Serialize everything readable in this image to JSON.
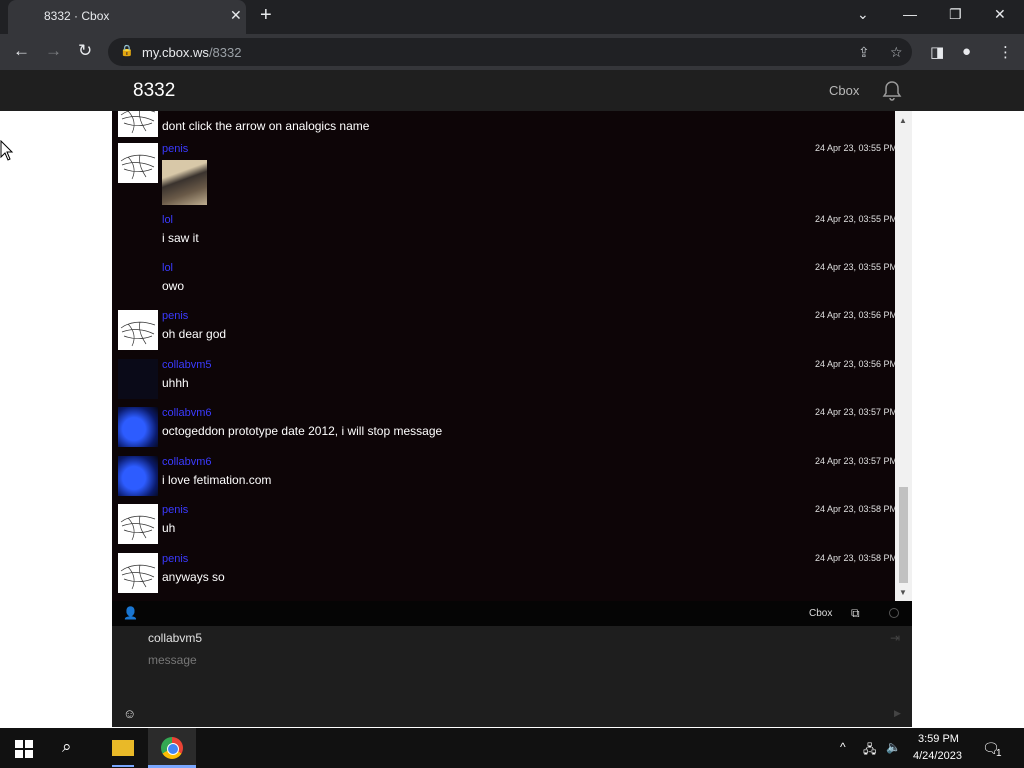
{
  "browser": {
    "tab_title": "8332 · Cbox",
    "tab_close": "✕",
    "new_tab": "+",
    "url_host": "my.cbox.ws",
    "url_path": "/8332"
  },
  "header": {
    "title": "8332",
    "link": "Cbox"
  },
  "messages": [
    {
      "user": "",
      "text": "dont click the arrow on analogics name",
      "time": "",
      "avatar": "sketch"
    },
    {
      "user": "penis",
      "text": "",
      "time": "24 Apr 23, 03:55 PM",
      "avatar": "sketch",
      "image": true
    },
    {
      "user": "lol",
      "text": "i saw it",
      "time": "24 Apr 23, 03:55 PM",
      "avatar": "none"
    },
    {
      "user": "lol",
      "text": "owo",
      "time": "24 Apr 23, 03:55 PM",
      "avatar": "none"
    },
    {
      "user": "penis",
      "text": "oh dear god",
      "time": "24 Apr 23, 03:56 PM",
      "avatar": "sketch"
    },
    {
      "user": "collabvm5",
      "text": "uhhh",
      "time": "24 Apr 23, 03:56 PM",
      "avatar": "dark"
    },
    {
      "user": "collabvm6",
      "text": "octogeddon prototype date 2012, i will stop message",
      "time": "24 Apr 23, 03:57 PM",
      "avatar": "blue"
    },
    {
      "user": "collabvm6",
      "text": "i love fetimation.com",
      "time": "24 Apr 23, 03:57 PM",
      "avatar": "blue"
    },
    {
      "user": "penis",
      "text": "uh",
      "time": "24 Apr 23, 03:58 PM",
      "avatar": "sketch"
    },
    {
      "user": "penis",
      "text": "anyways so",
      "time": "24 Apr 23, 03:58 PM",
      "avatar": "sketch"
    }
  ],
  "chat_bar": {
    "cbox_link": "Cbox"
  },
  "post_form": {
    "name_value": "collabvm5",
    "message_placeholder": "message"
  },
  "taskbar": {
    "time": "3:59 PM",
    "date": "4/24/2023",
    "notifications": "1"
  }
}
